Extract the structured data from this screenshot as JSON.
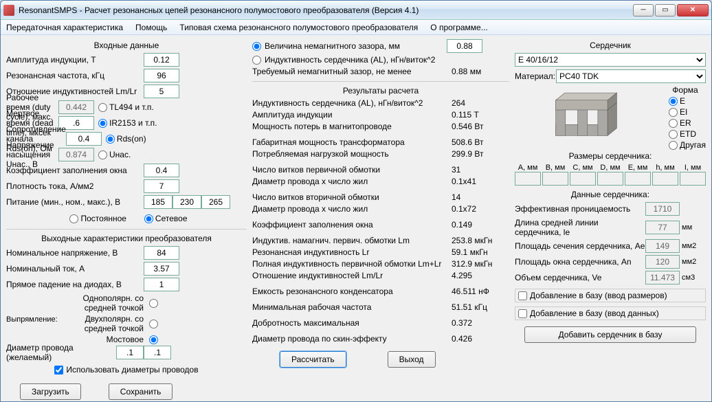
{
  "window": {
    "title": "ResonantSMPS - Расчет резонансных цепей резонансного полумостового преобразователя (Версия 4.1)"
  },
  "menu": {
    "m1": "Передаточная характеристика",
    "m2": "Помощь",
    "m3": "Типовая схема резонансного полумостового преобразователя",
    "m4": "О программе..."
  },
  "input": {
    "title": "Входные данные",
    "amp_label": "Амплитуда индукции, Т",
    "amp": "0.12",
    "fres_label": "Резонансная частота, кГц",
    "fres": "96",
    "lmlr_label": "Отношение индуктивностей Lm/Lr",
    "lmlr": "5",
    "duty_label": "Рабочее время (duty cycle), макс.",
    "duty": "0.442",
    "duty_r": "TL494 и т.п.",
    "dead_label": "Мертвое время (dead time), мксек",
    "dead": ".6",
    "dead_r": "IR2153 и т.п.",
    "rds_label": "Сопротивление канала Rds(on), Ом",
    "rds": "0.4",
    "rds_r": "Rds(on)",
    "usat_label": "Напряжение насыщения Uнас., В",
    "usat": "0.874",
    "usat_r": "Uнас.",
    "kw_label": "Коэффициент заполнения окна",
    "kw": "0.4",
    "jc_label": "Плотность тока, А/мм2",
    "jc": "7",
    "supply_label": "Питание (мин., ном., макс.), В",
    "supply_min": "185",
    "supply_nom": "230",
    "supply_max": "265",
    "mode_const": "Постоянное",
    "mode_net": "Сетевое",
    "out_title": "Выходные характеристики преобразователя",
    "uout_label": "Номинальное напряжение, В",
    "uout": "84",
    "iout_label": "Номинальный ток, А",
    "iout": "3.57",
    "vdio_label": "Прямое падение на диодах, В",
    "vdio": "1",
    "rect_label": "Выпрямление:",
    "rect1": "Однополярн. со средней точкой",
    "rect2": "Двухполярн. со средней точкой",
    "rect3": "Мостовое",
    "wire_label": "Диаметр провода (желаемый)",
    "wire1": ".1",
    "wire2": ".1",
    "usewire": "Использовать диаметры проводов",
    "load": "Загрузить",
    "save": "Сохранить"
  },
  "midtop": {
    "opt1": "Величина немагнитного зазора, мм",
    "opt1v": "0.88",
    "opt2": "Индуктивность сердечника (AL), нГн/виток^2",
    "req_label": "Требуемый немагнитный зазор, не менее",
    "req_v": "0.88 мм"
  },
  "results": {
    "title": "Результаты расчета",
    "r1l": "Индуктивность сердечника (AL), нГн/виток^2",
    "r1v": "264",
    "r2l": "Амплитуда индукции",
    "r2v": "0.115 Т",
    "r3l": "Мощность потерь в магнитопроводе",
    "r3v": "0.546 Вт",
    "r4l": "Габаритная мощность трансформатора",
    "r4v": "508.6 Вт",
    "r5l": "Потребляемая нагрузкой мощность",
    "r5v": "299.9 Вт",
    "r6l": "Число витков первичной обмотки",
    "r6v": "31",
    "r7l": "Диаметр провода x число жил",
    "r7v": "0.1x41",
    "r8l": "Число витков вторичной обмотки",
    "r8v": "14",
    "r9l": "Диаметр провода x число жил",
    "r9v": "0.1x72",
    "r10l": "Коэффициент заполнения окна",
    "r10v": "0.149",
    "r11l": "Индуктив. намагнич. первич. обмотки Lm",
    "r11v": "253.8 мкГн",
    "r12l": "Резонансная индуктивность Lr",
    "r12v": "59.1 мкГн",
    "r13l": "Полная индуктивность первичной обмотки  Lm+Lr",
    "r13v": "312.9 мкГн",
    "r14l": "Отношение индуктивностей Lm/Lr",
    "r14v": "4.295",
    "r15l": "Емкость резонансного конденсатора",
    "r15v": "46.511 нФ",
    "r16l": "Минимальная рабочая частота",
    "r16v": "51.51 кГц",
    "r17l": "Добротность максимальная",
    "r17v": "0.372",
    "r18l": "Диаметр провода по скин-эффекту",
    "r18v": "0.426",
    "calc": "Рассчитать",
    "exit": "Выход"
  },
  "core": {
    "title": "Сердечник",
    "core_select": "E 40/16/12",
    "mat_label": "Материал:",
    "mat": "PC40 TDK",
    "shape_label": "Форма",
    "sh1": "E",
    "sh2": "EI",
    "sh3": "ER",
    "sh4": "ETD",
    "sh5": "Другая",
    "dims_title": "Размеры сердечника:",
    "d1": "A, мм",
    "d2": "B, мм",
    "d3": "C, мм",
    "d4": "D, мм",
    "d5": "E, мм",
    "d6": "h, мм",
    "d7": "I, мм",
    "data_title": "Данные сердечника:",
    "perm_label": "Эффективная проницаемость",
    "perm": "1710",
    "le_label": "Длина средней линии сердечника, le",
    "le": "77",
    "le_u": "мм",
    "ae_label": "Площадь сечения сердечника, Ae",
    "ae": "149",
    "ae_u": "мм2",
    "an_label": "Площадь окна сердечника, An",
    "an": "120",
    "an_u": "мм2",
    "ve_label": "Объем сердечника, Ve",
    "ve": "11.473",
    "ve_u": "см3",
    "chk1": "Добавление в базу (ввод размеров)",
    "chk2": "Добавление в базу (ввод данных)",
    "addbtn": "Добавить сердечник в базу"
  }
}
